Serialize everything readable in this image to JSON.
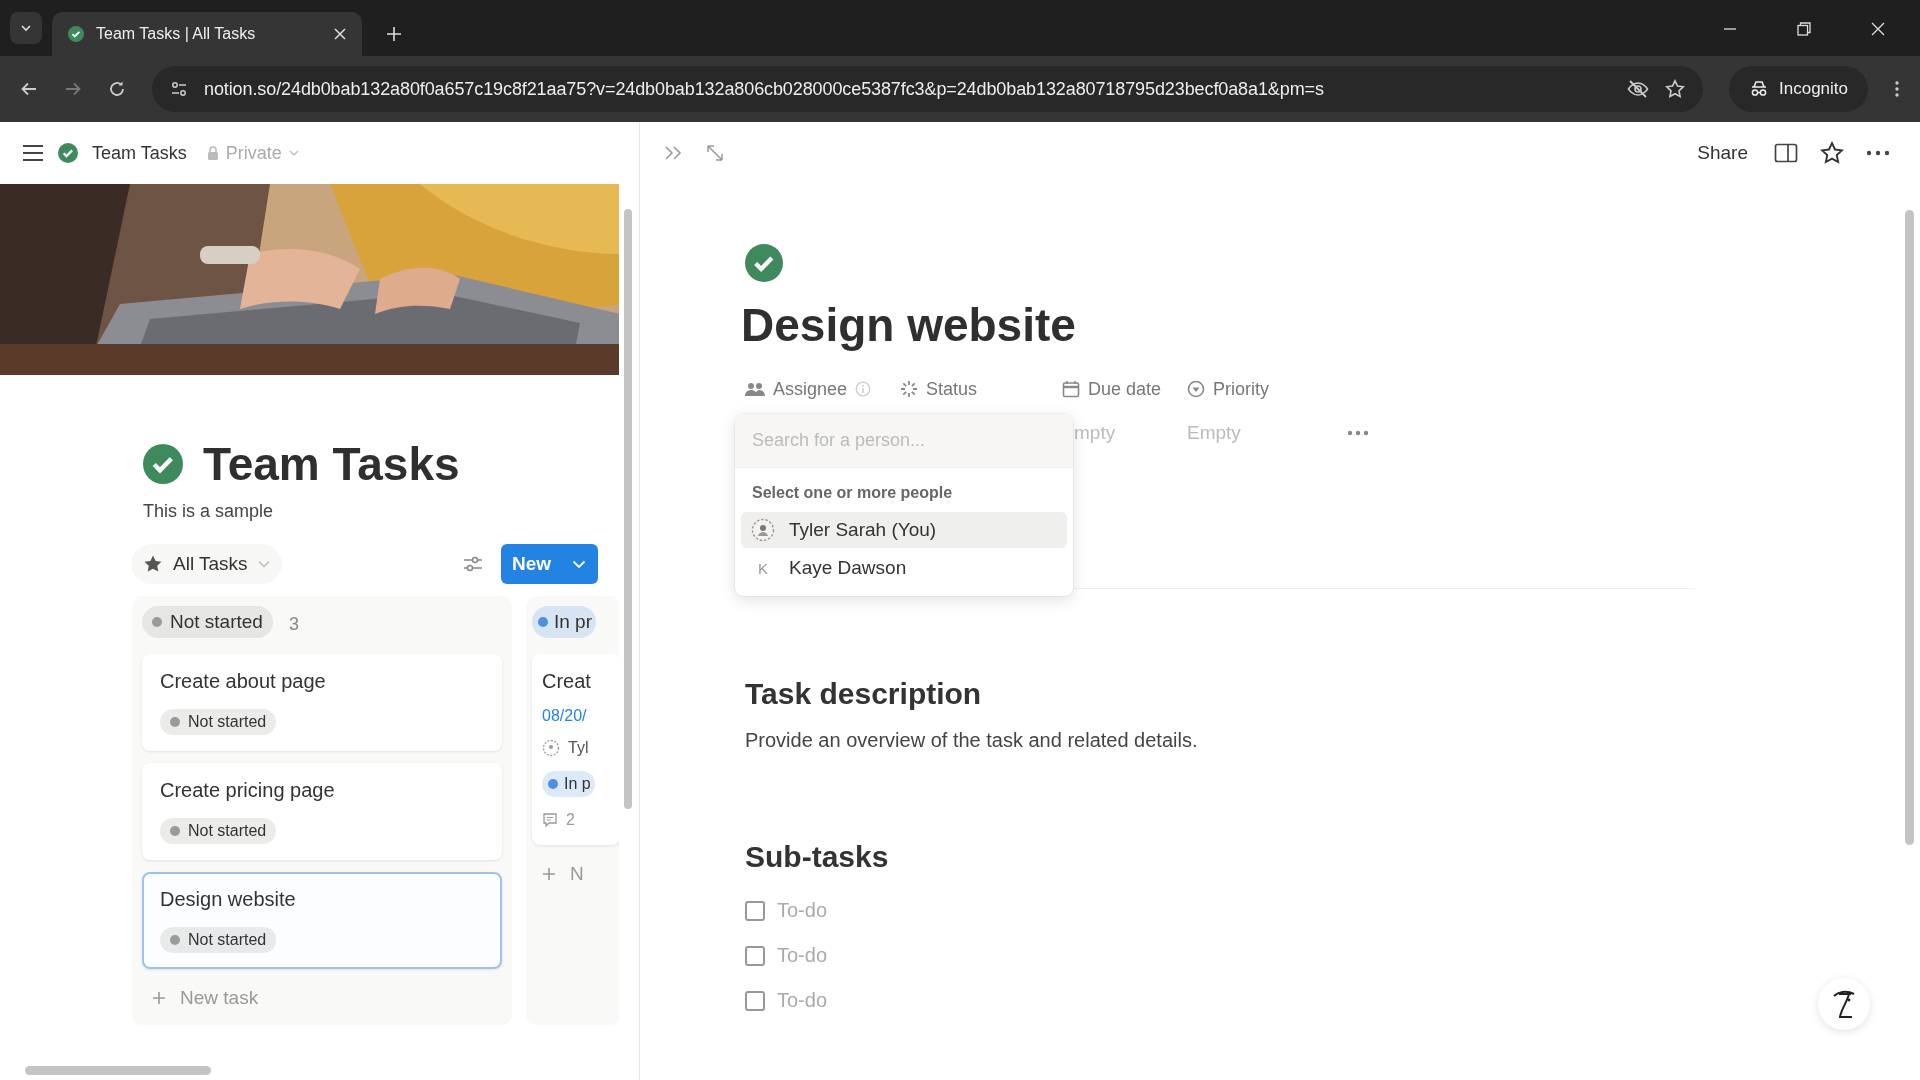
{
  "browser": {
    "tab": {
      "title": "Team Tasks | All Tasks"
    },
    "url": "notion.so/24db0bab132a80f0a657c19c8f21aa75?v=24db0bab132a806cb028000ce5387fc3&p=24db0bab132a80718795d23becf0a8a1&pm=s",
    "profile": "Incognito"
  },
  "topbar": {
    "breadcrumb": "Team Tasks",
    "visibility": "Private",
    "share": "Share"
  },
  "database": {
    "title": "Team Tasks",
    "description": "This is a sample",
    "view": "All Tasks",
    "new_button": "New",
    "groups": [
      {
        "label": "Not started",
        "count": "3",
        "color": "#9b9a97",
        "add_label": "New task",
        "cards": [
          {
            "title": "Create about page",
            "status": "Not started",
            "selected": false
          },
          {
            "title": "Create pricing page",
            "status": "Not started",
            "selected": false
          },
          {
            "title": "Design website",
            "status": "Not started",
            "selected": true
          }
        ]
      },
      {
        "label": "In pr",
        "color": "#4f8fe0",
        "add_label": "N",
        "cards": [
          {
            "title": "Creat",
            "date": "08/20/",
            "assignee": "Tyl",
            "status": "In p",
            "comments": "2",
            "selected": false
          }
        ]
      }
    ]
  },
  "page": {
    "title": "Design website",
    "properties": [
      {
        "name": "Assignee",
        "kind": "person"
      },
      {
        "name": "Status",
        "kind": "status"
      },
      {
        "name": "Due date",
        "kind": "date",
        "value": "mpty"
      },
      {
        "name": "Priority",
        "kind": "select",
        "value": "Empty"
      }
    ],
    "person_picker": {
      "placeholder": "Search for a person...",
      "heading": "Select one or more people",
      "people": [
        {
          "name": "Tyler Sarah (You)",
          "highlighted": true
        },
        {
          "name": "Kaye Dawson",
          "kind": "initial",
          "initial": "K",
          "highlighted": false
        }
      ]
    },
    "sections": [
      {
        "heading": "Task description",
        "text": "Provide an overview of the task and related details."
      },
      {
        "heading": "Sub-tasks",
        "todos": [
          {
            "text": "To-do",
            "checked": false
          },
          {
            "text": "To-do",
            "checked": false
          },
          {
            "text": "To-do",
            "checked": false
          }
        ]
      }
    ]
  }
}
